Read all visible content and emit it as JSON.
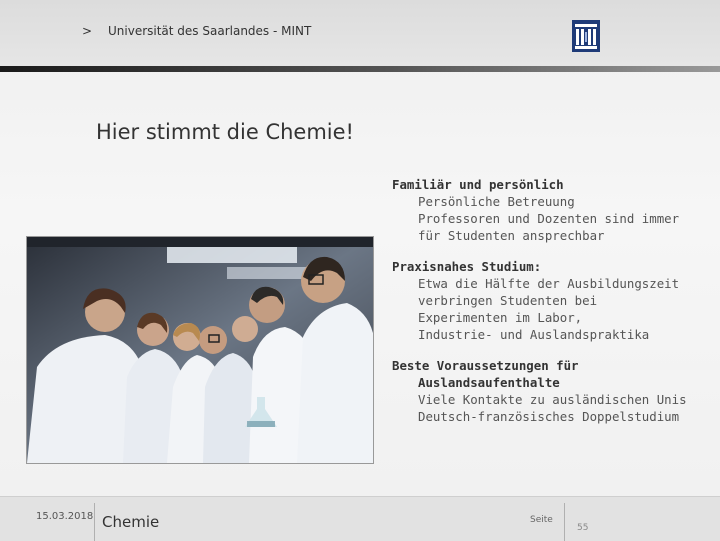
{
  "header": {
    "chevron": ">",
    "title": "Universität des Saarlandes - MINT"
  },
  "slide": {
    "title": "Hier stimmt die Chemie!",
    "blocks": [
      {
        "title": "Familiär und persönlich",
        "lines": [
          "Persönliche Betreuung",
          "Professoren und Dozenten sind immer",
          "für Studenten ansprechbar"
        ]
      },
      {
        "title": "Praxisnahes Studium:",
        "lines": [
          "Etwa die Hälfte der Ausbildungszeit",
          "verbringen Studenten bei",
          "Experimenten im Labor,",
          "Industrie- und Auslandspraktika"
        ]
      },
      {
        "title": "Beste Voraussetzungen für",
        "title2": "Auslandsaufenthalte",
        "lines": [
          "Viele Kontakte zu ausländischen Unis",
          "Deutsch-französisches Doppelstudium"
        ]
      }
    ]
  },
  "footer": {
    "date": "15.03.2018",
    "topic": "Chemie",
    "page_label": "Seite",
    "page_number": "55"
  }
}
